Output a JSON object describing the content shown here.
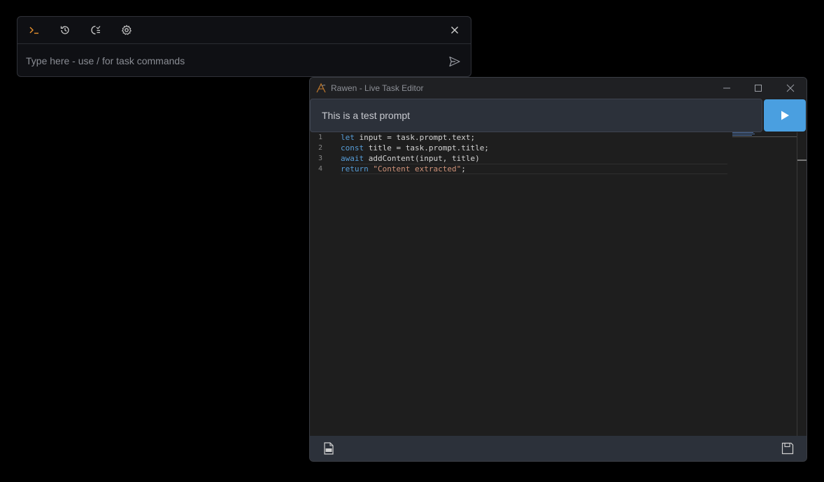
{
  "command_bar": {
    "toolbar": {
      "terminal_icon": "terminal-icon",
      "history_icon": "history-icon",
      "tasks_icon": "task-list-icon",
      "settings_icon": "gear-icon",
      "close_icon": "close-icon"
    },
    "input": {
      "placeholder": "Type here - use / for task commands",
      "value": ""
    },
    "send_icon": "send-icon",
    "accent": "#e8912d"
  },
  "editor": {
    "title": "Rawen - Live Task Editor",
    "prompt": {
      "value": "This is a test prompt"
    },
    "run_color": "#4a9fe0",
    "code_lines": [
      {
        "number": "1",
        "keyword": "let",
        "rest": " input = task.prompt.text;"
      },
      {
        "number": "2",
        "keyword": "const",
        "rest": " title = task.prompt.title;"
      },
      {
        "number": "3",
        "keyword": "await",
        "rest": " addContent(input, title)"
      },
      {
        "number": "4",
        "keyword": "return",
        "string": "\"Content extracted\"",
        "tail": ";"
      }
    ],
    "status_icons": {
      "doc": "doc-file-icon",
      "save": "save-icon"
    }
  }
}
